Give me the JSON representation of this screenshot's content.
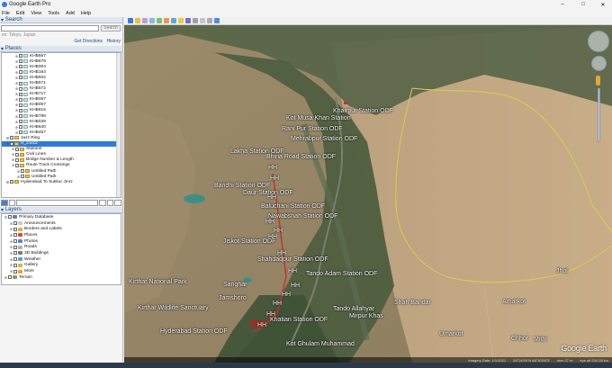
{
  "window": {
    "title": "Google Earth Pro",
    "minimize": "–",
    "maximize": "□",
    "close": "✕"
  },
  "menu": [
    "File",
    "Edit",
    "View",
    "Tools",
    "Add",
    "Help"
  ],
  "search": {
    "header": "Search",
    "placeholder": "",
    "button": "Search",
    "hint": "ex: Tokyo, Japan",
    "get_directions": "Get Directions",
    "history": "History"
  },
  "places": {
    "header": "Places",
    "items": [
      {
        "label": "KHB557"
      },
      {
        "label": "KHB579"
      },
      {
        "label": "KHB004"
      },
      {
        "label": "KHB164"
      },
      {
        "label": "KHB502"
      },
      {
        "label": "KHB571"
      },
      {
        "label": "KHB572"
      },
      {
        "label": "KHB717"
      },
      {
        "label": "KHB067"
      },
      {
        "label": "KHB057"
      },
      {
        "label": "KHB815"
      },
      {
        "label": "KHB798"
      },
      {
        "label": "KHB039"
      },
      {
        "label": "KHB640"
      },
      {
        "label": "KHB457"
      },
      {
        "label": "Jazz Ring"
      },
      {
        "label": "H_2.kmz",
        "selected": true
      },
      {
        "label": "Stations"
      },
      {
        "label": "Civil Lines"
      },
      {
        "label": "Bridge Number & Length"
      },
      {
        "label": "Route Track Crossings"
      },
      {
        "label": "Untitled Path"
      },
      {
        "label": "Untitled Path"
      },
      {
        "label": "Hyderabad To Sukkur Jmrz"
      }
    ]
  },
  "layers": {
    "header": "Layers",
    "items": [
      {
        "label": "Primary Database",
        "color": "#6b7fa8"
      },
      {
        "label": "Announcements",
        "color": "#c9c9c9"
      },
      {
        "label": "Borders and Labels",
        "color": "#d9b24a"
      },
      {
        "label": "Places",
        "color": "#d84a3a"
      },
      {
        "label": "Photos",
        "color": "#4a8ad8"
      },
      {
        "label": "Roads",
        "color": "#b0b0b0"
      },
      {
        "label": "3D Buildings",
        "color": "#7a7a7a"
      },
      {
        "label": "Weather",
        "color": "#5aa0e0"
      },
      {
        "label": "Gallery",
        "color": "#e0b040"
      },
      {
        "label": "More",
        "color": "#f0a030"
      },
      {
        "label": "Terrain",
        "color": "#7aa060"
      }
    ]
  },
  "map": {
    "labels": [
      {
        "text": "Khairpur Station ODF"
      },
      {
        "text": "Kot Musa Khan Station"
      },
      {
        "text": "Rani Pur Station ODF"
      },
      {
        "text": "Mehrabpur Station ODF"
      },
      {
        "text": "Lakha Station ODF"
      },
      {
        "text": "Bhiria Road Station ODF"
      },
      {
        "text": "Bandhi Station ODF"
      },
      {
        "text": "Daur Station ODF"
      },
      {
        "text": "Baluchani Station ODF"
      },
      {
        "text": "Nawabshah Station ODF"
      },
      {
        "text": "Jiskot Station ODF"
      },
      {
        "text": "Shahdadpur Station ODF"
      },
      {
        "text": "Tando Adam Station ODF"
      },
      {
        "text": "Khatian Station ODF"
      },
      {
        "text": "Hyderabad Station ODF"
      },
      {
        "text": "Mirpur Khas"
      },
      {
        "text": "Tando Allahyar"
      },
      {
        "text": "Shah Bandar"
      },
      {
        "text": "Kot Ghulam Muhammad"
      },
      {
        "text": "Umarkot"
      },
      {
        "text": "Jhol"
      },
      {
        "text": "Sanghar"
      },
      {
        "text": "Amarkot"
      },
      {
        "text": "Kirthar National Park"
      },
      {
        "text": "Kirthar Wildlife Sanctuary"
      },
      {
        "text": "Jamshoro"
      },
      {
        "text": "Chhor"
      },
      {
        "text": "Mithi"
      }
    ],
    "hh": "HH",
    "status": {
      "imagery": "Imagery Date: 1/1/2021",
      "coords": "26°24'59\"N 68°40'50\"E",
      "elev": "elev 27 m",
      "eye": "eye alt 234.28 km"
    },
    "logo": "Google Earth"
  }
}
